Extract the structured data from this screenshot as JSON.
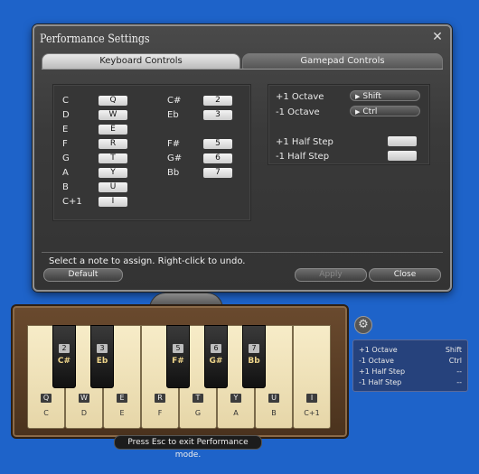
{
  "window": {
    "title": "Performance Settings",
    "close_icon": "close-x-icon",
    "tabs": {
      "keyboard": "Keyboard Controls",
      "gamepad": "Gamepad Controls"
    }
  },
  "naturals": [
    {
      "note": "C",
      "key": "Q"
    },
    {
      "note": "D",
      "key": "W"
    },
    {
      "note": "E",
      "key": "E"
    },
    {
      "note": "F",
      "key": "R"
    },
    {
      "note": "G",
      "key": "T"
    },
    {
      "note": "A",
      "key": "Y"
    },
    {
      "note": "B",
      "key": "U"
    },
    {
      "note": "C+1",
      "key": "I"
    }
  ],
  "accidentals": [
    {
      "note": "C#",
      "key": "2"
    },
    {
      "note": "Eb",
      "key": "3"
    },
    {
      "note": "F#",
      "key": "5"
    },
    {
      "note": "G#",
      "key": "6"
    },
    {
      "note": "Bb",
      "key": "7"
    }
  ],
  "modifiers": {
    "octave_up": {
      "label": "+1 Octave",
      "value": "Shift"
    },
    "octave_down": {
      "label": "-1 Octave",
      "value": "Ctrl"
    },
    "half_up": {
      "label": "+1 Half Step",
      "value": ""
    },
    "half_down": {
      "label": "-1 Half Step",
      "value": ""
    }
  },
  "footer": {
    "hint": "Select a note to assign. Right-click to undo.",
    "default_btn": "Default",
    "apply_btn": "Apply",
    "close_btn": "Close"
  },
  "piano": {
    "white_keys": [
      {
        "tag": "Q",
        "note": "C"
      },
      {
        "tag": "W",
        "note": "D"
      },
      {
        "tag": "E",
        "note": "E"
      },
      {
        "tag": "R",
        "note": "F"
      },
      {
        "tag": "T",
        "note": "G"
      },
      {
        "tag": "Y",
        "note": "A"
      },
      {
        "tag": "U",
        "note": "B"
      },
      {
        "tag": "I",
        "note": "C+1"
      }
    ],
    "black_keys": [
      {
        "num": "2",
        "note": "C#"
      },
      {
        "num": "3",
        "note": "Eb"
      },
      {
        "num": "5",
        "note": "F#"
      },
      {
        "num": "6",
        "note": "G#"
      },
      {
        "num": "7",
        "note": "Bb"
      }
    ],
    "gear_icon": "gear-icon"
  },
  "info_panel": [
    {
      "k": "+1 Octave",
      "v": "Shift"
    },
    {
      "k": "-1 Octave",
      "v": "Ctrl"
    },
    {
      "k": "+1 Half Step",
      "v": "--"
    },
    {
      "k": "-1 Half Step",
      "v": "--"
    }
  ],
  "esc_hint": "Press Esc to exit Performance mode."
}
